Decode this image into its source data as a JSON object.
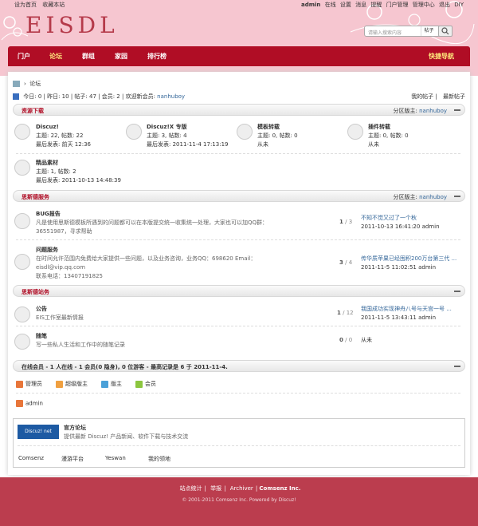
{
  "top_links": [
    "设为首页",
    "收藏本站"
  ],
  "user_nav": {
    "username": "admin",
    "links": [
      "在线",
      "设置",
      "消息",
      "提醒",
      "门户管理",
      "管理中心",
      "退出",
      "DIY"
    ]
  },
  "logo_text": "EISDL",
  "search": {
    "placeholder": "请输入搜索内容",
    "type": "帖子"
  },
  "nav": {
    "items": [
      "门户",
      "论坛",
      "群组",
      "家园",
      "排行榜"
    ],
    "quick": "快捷导航"
  },
  "breadcrumb": "论坛",
  "stats": {
    "today": "今日: 0",
    "yesterday": "昨日: 10",
    "posts": "帖子: 47",
    "members": "会员: 2",
    "welcome_label": "欢迎新会员:",
    "welcome_user": "nanhuboy"
  },
  "right_links": [
    "我的帖子",
    "最新帖子"
  ],
  "cat1": {
    "title": "资源下载",
    "moderator_label": "分区版主:",
    "moderator": "nanhuboy",
    "forums": [
      {
        "name": "Discuz!",
        "counts": "主题: 22, 帖数: 22",
        "last": "最后发表: 前天 12:36"
      },
      {
        "name": "Discuz!X 专版",
        "counts": "主题: 3, 帖数: 4",
        "last": "最后发表: 2011-11-4 17:13:19"
      },
      {
        "name": "模板转载",
        "counts": "主题: 0, 帖数: 0",
        "last": "从未"
      },
      {
        "name": "插件转载",
        "counts": "主题: 0, 帖数: 0",
        "last": "从未"
      },
      {
        "name": "精品素材",
        "counts": "主题: 1, 帖数: 2",
        "last": "最后发表: 2011-10-13 14:48:39"
      }
    ]
  },
  "cat2": {
    "title": "思斯德服务",
    "moderator_label": "分区版主:",
    "moderator": "nanhuboy",
    "forums": [
      {
        "name": "BUG报告",
        "desc1": "凡是使用思斯德模板所遇到的问题都可以在本版提交统一收集统一处理，大家也可以加QQ群：",
        "desc2": "36551987，寻求帮助",
        "count_a": "1",
        "count_b": "3",
        "last_title": "不知不觉又过了一个秋",
        "last_info": "2011-10-13 16:41:20 admin"
      },
      {
        "name": "问题服务",
        "desc1": "在时间允许范围内免费给大家提供一些问题，以及业务咨询，业务QQ：698620 Email：",
        "desc2": "eisdl@vip.qq.com",
        "desc3": "联系电话：13407191825",
        "count_a": "3",
        "count_b": "4",
        "last_title": "传华质苹果已经囤积200万台第三代 ...",
        "last_info": "2011-11-5 11:02:51 admin"
      }
    ]
  },
  "cat3": {
    "title": "思斯德站务",
    "forums": [
      {
        "name": "公告",
        "desc1": "EIS工作室最新情报",
        "count_a": "1",
        "count_b": "12",
        "last_title": "我国成功实现神舟八号与天宫一号 ...",
        "last_info": "2011-11-5 13:43:11 admin"
      },
      {
        "name": "随笔",
        "desc1": "写一些私人生活和工作中的随笔记录",
        "count_a": "0",
        "count_b": "0",
        "last_title": "从未"
      }
    ]
  },
  "online": {
    "title": "在线会员 - 1 人在线 - 1 会员(0 隐身), 0 位游客 - 最高记录是 6 于 2011-11-4.",
    "legend": [
      {
        "label": "管理员",
        "color": "#e8763a"
      },
      {
        "label": "超级版主",
        "color": "#f0a040"
      },
      {
        "label": "版主",
        "color": "#4aa0d8"
      },
      {
        "label": "会员",
        "color": "#8cc63f"
      }
    ],
    "users": [
      "admin"
    ]
  },
  "friend_links": {
    "logo": "Discuz! net",
    "title": "官方论坛",
    "desc": "提供最新 Discuz! 产品新闻、软件下载与技术交流",
    "links": [
      "Comsenz",
      "漫游平台",
      "Yeswan",
      "我的领地"
    ]
  },
  "footer": {
    "links": [
      "站点统计",
      "举报",
      "Archiver"
    ],
    "brand": "Comsenz Inc.",
    "copyright": "© 2001-2011 Comsenz Inc. Powered by Discuz!"
  }
}
